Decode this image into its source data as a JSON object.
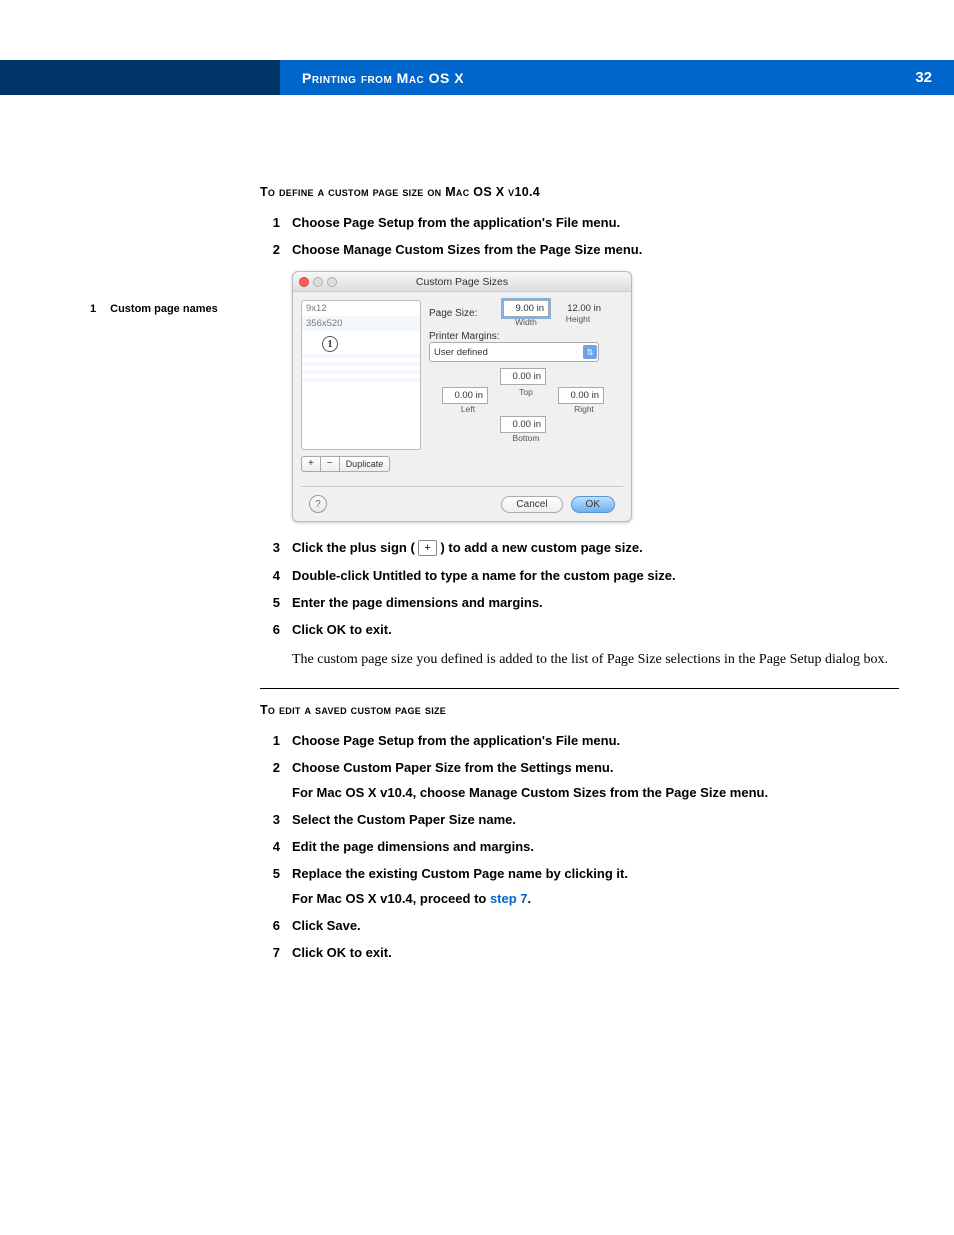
{
  "header": {
    "title": "Printing from Mac OS X",
    "page_number": "32"
  },
  "callout": {
    "num": "1",
    "label": "Custom page names"
  },
  "section1": {
    "title": "To define a custom page size on Mac OS X v10.4",
    "steps": [
      {
        "n": "1",
        "text": "Choose Page Setup from the application's File menu."
      },
      {
        "n": "2",
        "text": "Choose Manage Custom Sizes from the Page Size menu."
      }
    ],
    "steps_after": [
      {
        "n": "3",
        "prefix": "Click the plus sign ( ",
        "suffix": " ) to add a new custom page size."
      },
      {
        "n": "4",
        "text": "Double-click Untitled to type a name for the custom page size."
      },
      {
        "n": "5",
        "text": "Enter the page dimensions and margins."
      },
      {
        "n": "6",
        "text": "Click OK to exit."
      }
    ],
    "body": "The custom page size you defined is added to the list of Page Size selections in the Page Setup dialog box."
  },
  "section2": {
    "title": "To edit a saved custom page size",
    "steps": [
      {
        "n": "1",
        "text": "Choose Page Setup from the application's File menu."
      },
      {
        "n": "2",
        "text": "Choose Custom Paper Size from the Settings menu."
      },
      {
        "sub": "For Mac OS X v10.4, choose Manage Custom Sizes from the Page Size menu."
      },
      {
        "n": "3",
        "text": "Select the Custom Paper Size name."
      },
      {
        "n": "4",
        "text": "Edit the page dimensions and margins."
      },
      {
        "n": "5",
        "text": "Replace the existing Custom Page name by clicking it."
      },
      {
        "sub_prefix": "For Mac OS X v10.4, proceed to ",
        "sub_link": "step 7",
        "sub_suffix": "."
      },
      {
        "n": "6",
        "text": "Click Save."
      },
      {
        "n": "7",
        "text": "Click OK to exit."
      }
    ]
  },
  "dialog": {
    "title": "Custom Page Sizes",
    "list_items": [
      "9x12",
      "356x520"
    ],
    "callout_badge": "1",
    "buttons": {
      "plus": "+",
      "minus": "−",
      "duplicate": "Duplicate"
    },
    "page_size_label": "Page Size:",
    "width_value": "9.00 in",
    "height_value": "12.00 in",
    "width_caption": "Width",
    "height_caption": "Height",
    "printer_margins_label": "Printer Margins:",
    "dropdown_value": "User defined",
    "margins": {
      "top_value": "0.00 in",
      "top_caption": "Top",
      "left_value": "0.00 in",
      "left_caption": "Left",
      "right_value": "0.00 in",
      "right_caption": "Right",
      "bottom_value": "0.00 in",
      "bottom_caption": "Bottom"
    },
    "help": "?",
    "cancel": "Cancel",
    "ok": "OK"
  },
  "plus_icon": "+"
}
